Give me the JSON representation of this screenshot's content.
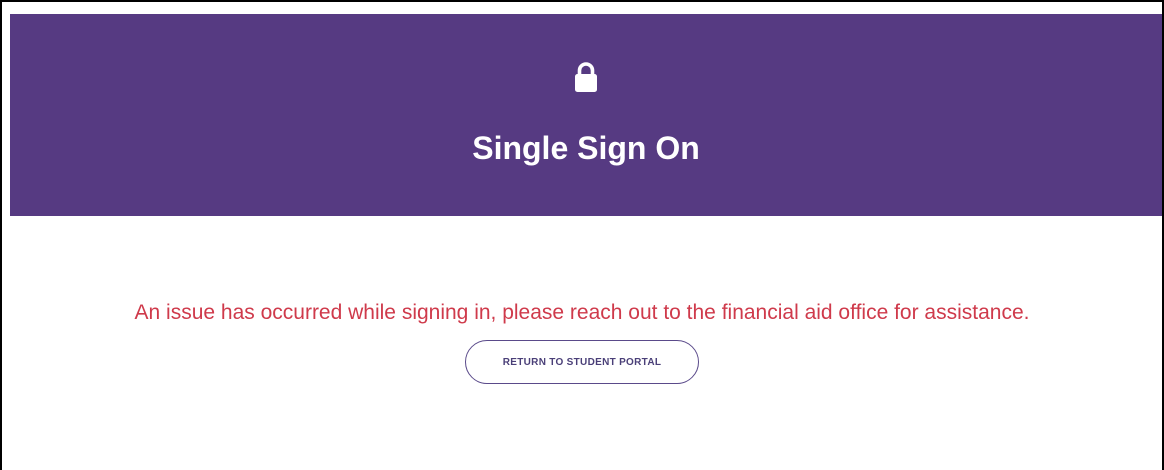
{
  "header": {
    "icon": "lock-icon",
    "title": "Single Sign On"
  },
  "main": {
    "error_message": "An issue has occurred while signing in, please reach out to the financial aid office for assistance.",
    "return_button_label": "RETURN TO STUDENT PORTAL"
  },
  "colors": {
    "header_background": "#563a82",
    "error_text": "#cf3a4b",
    "button_border": "#5a4a8a"
  }
}
